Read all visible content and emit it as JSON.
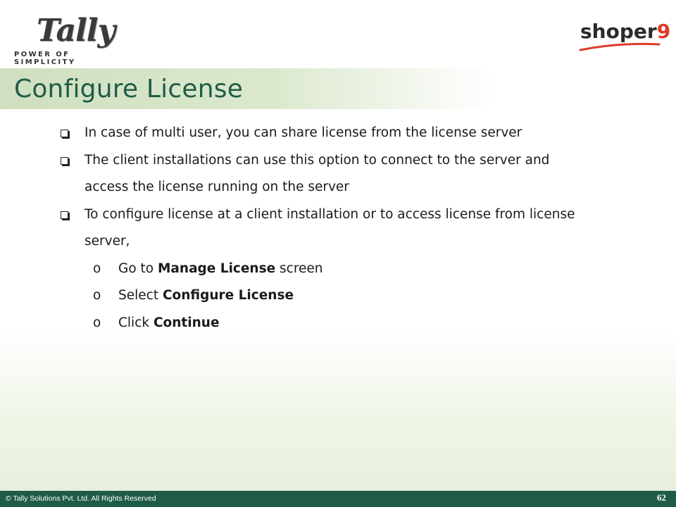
{
  "header": {
    "tally_logo_text": "Tally",
    "tally_tagline": "POWER OF SIMPLICITY",
    "shoper_logo_text": "shoper",
    "shoper_logo_number": "9"
  },
  "title": "Configure License",
  "bullets": [
    {
      "lines": [
        "In case of multi user, you can share license from the license server"
      ]
    },
    {
      "lines": [
        "The client installations can use this option to connect to the server and",
        "access the license running on the server"
      ]
    },
    {
      "lines": [
        "To configure license at a client installation or to access license from license",
        "server,"
      ]
    }
  ],
  "steps": [
    {
      "marker": "o",
      "prefix": "Go to ",
      "bold": "Manage License",
      "suffix": " screen"
    },
    {
      "marker": "o",
      "prefix": "Select ",
      "bold": "Configure License",
      "suffix": ""
    },
    {
      "marker": "o",
      "prefix": "Click ",
      "bold": "Continue",
      "suffix": ""
    }
  ],
  "footer": {
    "copyright": "© Tally Solutions Pvt. Ltd. All Rights Reserved",
    "page_number": "62"
  },
  "colors": {
    "title": "#1f5c48",
    "footer_bg": "#1f5c48",
    "shoper_accent": "#e03a2a"
  }
}
